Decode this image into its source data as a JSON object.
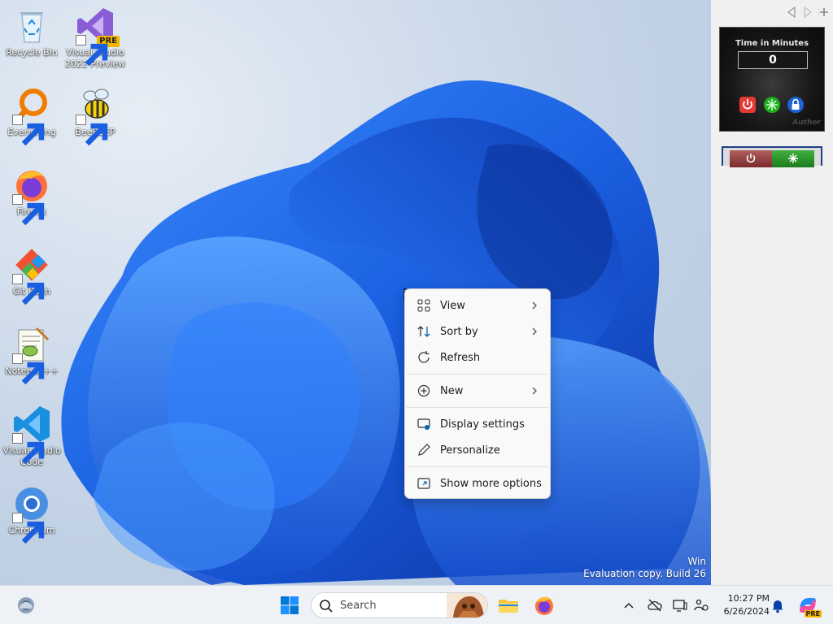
{
  "desktop": {
    "icons": [
      {
        "id": "recycle-bin",
        "label_lines": [
          "Recycle Bin"
        ],
        "icon": "recycle-bin-icon",
        "shortcut": false
      },
      {
        "id": "visual-studio-2022-preview",
        "label_lines": [
          "Visual Studio",
          "2022 Preview"
        ],
        "icon": "visual-studio-preview-icon",
        "shortcut": true,
        "badge": "PRE"
      },
      {
        "id": "everything",
        "label_lines": [
          "Everything"
        ],
        "icon": "everything-search-icon",
        "shortcut": true
      },
      {
        "id": "beebeep",
        "label_lines": [
          "BeeBEEP"
        ],
        "icon": "bee-icon",
        "shortcut": true
      },
      {
        "id": "firefox",
        "label_lines": [
          "Firefox"
        ],
        "icon": "firefox-icon",
        "shortcut": true
      },
      {
        "id": "git-bash",
        "label_lines": [
          "Git Bash"
        ],
        "icon": "git-bash-icon",
        "shortcut": true
      },
      {
        "id": "notepad-plus-plus",
        "label_lines": [
          "Notepad++"
        ],
        "icon": "notepad-plus-plus-icon",
        "shortcut": true
      },
      {
        "id": "vscode",
        "label_lines": [
          "Visual Studio",
          "Code"
        ],
        "icon": "vscode-icon",
        "shortcut": true
      },
      {
        "id": "chromium",
        "label_lines": [
          "Chromium"
        ],
        "icon": "chromium-icon",
        "shortcut": true
      }
    ],
    "watermark": {
      "line1": "Win",
      "line2": "Evaluation copy. Build 26"
    }
  },
  "context_menu": {
    "items": [
      {
        "label": "View",
        "icon": "grid-view-icon",
        "submenu": true
      },
      {
        "label": "Sort by",
        "icon": "sort-arrows-icon",
        "submenu": true
      },
      {
        "label": "Refresh",
        "icon": "refresh-icon",
        "submenu": false
      },
      {
        "label": "New",
        "icon": "plus-circle-icon",
        "submenu": true
      },
      {
        "label": "Display settings",
        "icon": "display-icon",
        "submenu": false
      },
      {
        "label": "Personalize",
        "icon": "pen-icon",
        "submenu": false
      },
      {
        "label": "Show more options",
        "icon": "expand-icon",
        "submenu": false
      }
    ]
  },
  "sidebar": {
    "timer": {
      "label": "Time in Minutes",
      "value": "0",
      "brand": "Author"
    }
  },
  "taskbar": {
    "search_placeholder": "Search",
    "clock": {
      "time": "10:27 PM",
      "date": "6/26/2024"
    },
    "copilot_badge": "PRE"
  },
  "colors": {
    "accent": "#0067c0",
    "wallpaper_blue": "#1a5fe0",
    "menu_bg": "#f9f9f9",
    "taskbar_bg": "#eef1f6"
  }
}
